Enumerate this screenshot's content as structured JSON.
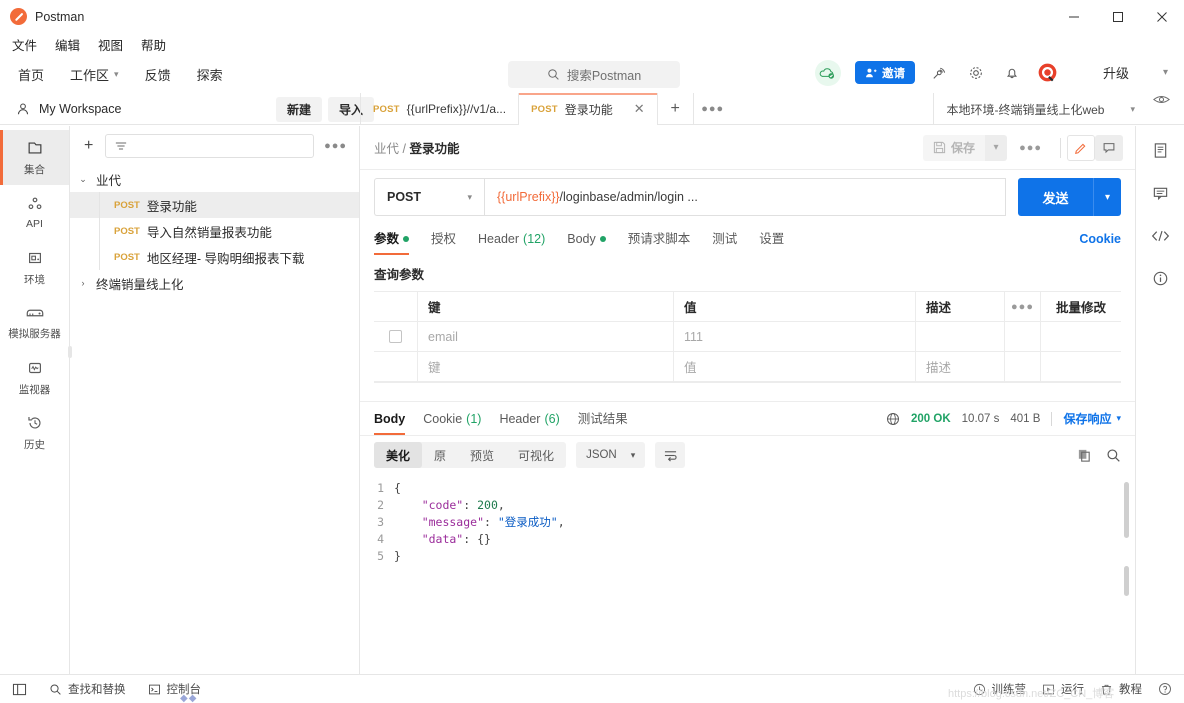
{
  "window": {
    "app_title": "Postman",
    "minimize": "─",
    "maximize": "□",
    "close": "✕"
  },
  "menubar": {
    "items": [
      "文件",
      "编辑",
      "视图",
      "帮助"
    ]
  },
  "navbar": {
    "links": [
      {
        "label": "首页",
        "caret": false
      },
      {
        "label": "工作区",
        "caret": true
      },
      {
        "label": "反馈",
        "caret": false
      },
      {
        "label": "探索",
        "caret": false
      }
    ],
    "search_placeholder": "搜索Postman",
    "invite_label": "邀请",
    "upgrade_label": "升级",
    "caret": "⌄",
    "icons": [
      "cloud-sync-icon",
      "satellite-icon",
      "gear-icon",
      "bell-icon",
      "account-icon"
    ]
  },
  "workspace": {
    "name": "My Workspace",
    "new_label": "新建",
    "import_label": "导入"
  },
  "tabs": [
    {
      "method": "POST",
      "name": "{{urlPrefix}}//v1/a...",
      "active": false
    },
    {
      "method": "POST",
      "name": "登录功能",
      "active": true
    }
  ],
  "environment": {
    "selected": "本地环境-终端销量线上化web",
    "caret": "⌄"
  },
  "sidebar_rail": [
    {
      "label": "集合",
      "icon": "collection-icon",
      "active": true
    },
    {
      "label": "API",
      "icon": "api-icon",
      "active": false
    },
    {
      "label": "环境",
      "icon": "environment-icon",
      "active": false
    },
    {
      "label": "模拟服务器",
      "icon": "mock-server-icon",
      "active": false
    },
    {
      "label": "监视器",
      "icon": "monitor-icon",
      "active": false
    },
    {
      "label": "历史",
      "icon": "history-icon",
      "active": false
    }
  ],
  "collections": {
    "filter_placeholder": "",
    "groups": [
      {
        "name": "业代",
        "expanded": true,
        "arrow": "⌄",
        "requests": [
          {
            "method": "POST",
            "name": "登录功能",
            "selected": true
          },
          {
            "method": "POST",
            "name": "导入自然销量报表功能",
            "selected": false
          },
          {
            "method": "POST",
            "name": "地区经理- 导购明细报表下载",
            "selected": false
          }
        ]
      },
      {
        "name": "终端销量线上化",
        "expanded": false,
        "arrow": "›",
        "requests": []
      }
    ]
  },
  "request": {
    "breadcrumb_collection": "业代",
    "breadcrumb_sep": "/",
    "breadcrumb_name": "登录功能",
    "save_label": "保存",
    "method": "POST",
    "url_variable": "{{urlPrefix}}",
    "url_rest": "/loginbase/admin/login ...",
    "send_label": "发送",
    "tabs": [
      {
        "label": "参数",
        "dot": true,
        "count": "",
        "active": true
      },
      {
        "label": "授权",
        "dot": false,
        "count": "",
        "active": false
      },
      {
        "label": "Header",
        "dot": false,
        "count": "(12)",
        "active": false
      },
      {
        "label": "Body",
        "dot": true,
        "count": "",
        "active": false
      },
      {
        "label": "预请求脚本",
        "dot": false,
        "count": "",
        "active": false
      },
      {
        "label": "测试",
        "dot": false,
        "count": "",
        "active": false
      },
      {
        "label": "设置",
        "dot": false,
        "count": "",
        "active": false
      }
    ],
    "cookie_link": "Cookie",
    "query_params_label": "查询参数",
    "table": {
      "headers": {
        "key": "键",
        "value": "值",
        "description": "描述",
        "bulk": "批量修改"
      },
      "rows": [
        {
          "checked": false,
          "key": "email",
          "value": "111",
          "description": "",
          "placeholder": false
        },
        {
          "checked": null,
          "key": "键",
          "value": "值",
          "description": "描述",
          "placeholder": true
        }
      ]
    }
  },
  "response": {
    "tabs": [
      {
        "label": "Body",
        "count": "",
        "active": true
      },
      {
        "label": "Cookie",
        "count": "(1)",
        "active": false
      },
      {
        "label": "Header",
        "count": "(6)",
        "active": false
      },
      {
        "label": "测试结果",
        "count": "",
        "active": false
      }
    ],
    "status": "200 OK",
    "time": "10.07 s",
    "size": "401 B",
    "save_response_label": "保存响应",
    "format_modes": [
      {
        "label": "美化",
        "active": true
      },
      {
        "label": "原",
        "active": false
      },
      {
        "label": "预览",
        "active": false
      },
      {
        "label": "可视化",
        "active": false
      }
    ],
    "content_type": "JSON",
    "body_lines": [
      {
        "n": "1",
        "segments": [
          {
            "t": "{",
            "c": "k-pun"
          }
        ]
      },
      {
        "n": "2",
        "segments": [
          {
            "t": "    \"code\"",
            "c": "k-key"
          },
          {
            "t": ": ",
            "c": "k-pun"
          },
          {
            "t": "200",
            "c": "k-num"
          },
          {
            "t": ",",
            "c": "k-pun"
          }
        ]
      },
      {
        "n": "3",
        "segments": [
          {
            "t": "    \"message\"",
            "c": "k-key"
          },
          {
            "t": ": ",
            "c": "k-pun"
          },
          {
            "t": "\"登录成功\"",
            "c": "k-str"
          },
          {
            "t": ",",
            "c": "k-pun"
          }
        ]
      },
      {
        "n": "4",
        "segments": [
          {
            "t": "    \"data\"",
            "c": "k-key"
          },
          {
            "t": ": ",
            "c": "k-pun"
          },
          {
            "t": "{}",
            "c": "k-pun"
          }
        ]
      },
      {
        "n": "5",
        "segments": [
          {
            "t": "}",
            "c": "k-pun"
          }
        ]
      }
    ]
  },
  "right_rail": [
    "documentation-icon",
    "comment-icon",
    "code-icon",
    "info-icon"
  ],
  "statusbar": {
    "left": [
      {
        "label": "查找和替换",
        "icon": "search-icon"
      },
      {
        "label": "控制台",
        "icon": "console-icon"
      }
    ],
    "right": [
      {
        "label": "训练营",
        "icon": "bootcamp-icon"
      },
      {
        "label": "运行",
        "icon": "runner-icon"
      },
      {
        "label": "教程",
        "icon": "trash-icon"
      }
    ],
    "watermark": "https://blog.csdn.net/ZC_CN_博客"
  },
  "colors": {
    "accent_orange": "#f26b3a",
    "blue": "#0f73e8",
    "green": "#21a366",
    "method_post": "#d9a23a"
  }
}
